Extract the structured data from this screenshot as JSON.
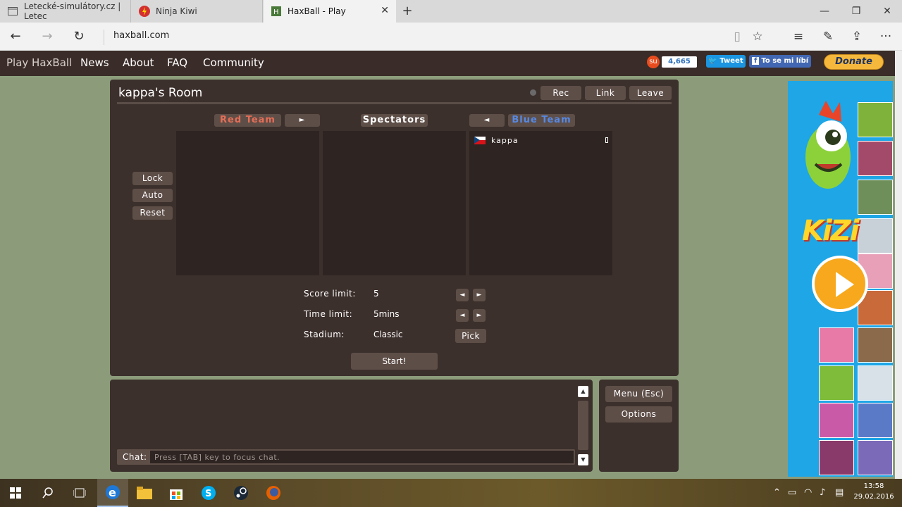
{
  "browser": {
    "tabs": [
      {
        "label": "Letecké-simulátory.cz | Letec"
      },
      {
        "label": "Ninja Kiwi"
      },
      {
        "label": "HaxBall - Play"
      }
    ],
    "url": "haxball.com"
  },
  "site_nav": {
    "items": [
      "Play HaxBall",
      "News",
      "About",
      "FAQ",
      "Community"
    ],
    "share_count": "4,665",
    "tweet_label": "Tweet",
    "like_label": "To se mi líbí",
    "donate_label": "Donate"
  },
  "room": {
    "title": "kappa's Room",
    "header_buttons": [
      "Rec",
      "Link",
      "Leave"
    ],
    "red_team_label": "Red Team",
    "spectators_label": "Spectators",
    "blue_team_label": "Blue Team",
    "move_right_glyph": "►",
    "move_left_glyph": "◄",
    "side_buttons": [
      "Lock",
      "Auto",
      "Reset"
    ],
    "players": {
      "blue": [
        {
          "name": "kappa",
          "flag": "CZ"
        }
      ]
    },
    "settings": {
      "score_limit_label": "Score limit:",
      "score_limit_value": "5",
      "time_limit_label": "Time limit:",
      "time_limit_value": "5mins",
      "stadium_label": "Stadium:",
      "stadium_value": "Classic",
      "pick_label": "Pick"
    },
    "start_label": "Start!"
  },
  "chat": {
    "label": "Chat:",
    "placeholder": "Press [TAB] key to focus chat."
  },
  "menu": {
    "menu_label": "Menu (Esc)",
    "options_label": "Options"
  },
  "ad": {
    "brand": "KiZi"
  },
  "taskbar": {
    "time": "13:58",
    "date": "29.02.2016"
  },
  "colors": {
    "panel": "#3c302c",
    "button": "#5e4e48",
    "red_team": "#e56e56",
    "blue_team": "#5689e5",
    "page_bg": "#8c9c7b"
  }
}
